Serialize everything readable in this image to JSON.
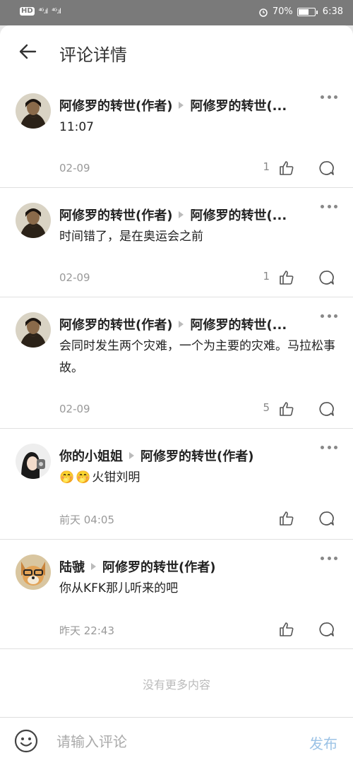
{
  "status_bar": {
    "hd": "HD",
    "signal_1": "⁴ᴳ.ıl",
    "signal_2": "⁴ᴳ.ıl",
    "alarm_icon": "alarm-icon",
    "battery_text": "70%",
    "battery_level": 0.7,
    "time": "6:38"
  },
  "header": {
    "title": "评论详情",
    "back_icon": "arrow-left-icon"
  },
  "comments": [
    {
      "author": "阿修罗的转世(作者)",
      "reply_to": "阿修罗的转世(...",
      "text": "11:07",
      "date": "02-09",
      "likes": "1",
      "avatar": "painting-portrait"
    },
    {
      "author": "阿修罗的转世(作者)",
      "reply_to": "阿修罗的转世(...",
      "text": "时间错了，是在奥运会之前",
      "date": "02-09",
      "likes": "1",
      "avatar": "painting-portrait"
    },
    {
      "author": "阿修罗的转世(作者)",
      "reply_to": "阿修罗的转世(...",
      "text": "会同时发生两个灾难，一个为主要的灾难。马拉松事故。",
      "date": "02-09",
      "likes": "5",
      "avatar": "painting-portrait"
    },
    {
      "author": "你的小姐姐",
      "reply_to": "阿修罗的转世(作者)",
      "text": "火钳刘明",
      "emojis": [
        "🤭",
        "🤭"
      ],
      "date": "前天 04:05",
      "likes": "",
      "avatar": "girl-photo"
    },
    {
      "author": "陆虢",
      "reply_to": "阿修罗的转世(作者)",
      "text": "你从KFK那儿听来的吧",
      "date": "昨天 22:43",
      "likes": "",
      "avatar": "dog-photo"
    }
  ],
  "footer_note": "没有更多内容",
  "input_bar": {
    "placeholder": "请输入评论",
    "send_label": "发布",
    "emoji_icon": "smiley-icon"
  },
  "colors": {
    "send_accent": "#9cc3e6",
    "meta_text": "#999999"
  }
}
